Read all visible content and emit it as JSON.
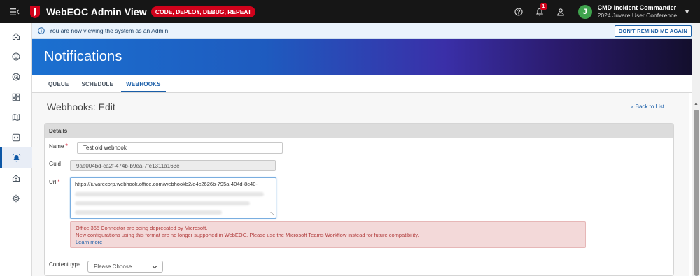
{
  "topbar": {
    "menu_icon": "menu-collapse-icon",
    "title": "WebEOC Admin View",
    "env_badge": "CODE, DEPLOY, DEBUG, REPEAT",
    "notification_count": "1",
    "user_name": "CMD Incident Commander",
    "user_org": "2024 Juvare User Conference",
    "avatar_letter": "J"
  },
  "sidebar": {
    "items": [
      {
        "name": "home-icon"
      },
      {
        "name": "user-circle-icon"
      },
      {
        "name": "radar-icon"
      },
      {
        "name": "dashboard-icon"
      },
      {
        "name": "map-icon"
      },
      {
        "name": "code-icon"
      },
      {
        "name": "alarm-bell-icon",
        "active": true
      },
      {
        "name": "house-settings-icon"
      },
      {
        "name": "gear-icon"
      }
    ]
  },
  "banner": {
    "message": "You are now viewing the system as an Admin.",
    "button": "DON'T REMIND ME AGAIN"
  },
  "hero": {
    "title": "Notifications"
  },
  "tabs": [
    {
      "label": "QUEUE"
    },
    {
      "label": "SCHEDULE"
    },
    {
      "label": "WEBHOOKS",
      "active": true
    }
  ],
  "page": {
    "title": "Webhooks: Edit",
    "back_link": "Back to List"
  },
  "details": {
    "header": "Details",
    "name_label": "Name",
    "name_value": "Test old webhook",
    "guid_label": "Guid",
    "guid_value": "9ae004bd-ca2f-474b-b9ea-7fe1311a163e",
    "url_label": "Url",
    "url_value": "https://iuvarecorp.webhook.office.com/webhookb2/e4c2626b-795a-404d-8c40-",
    "alert_line1": "Office 365 Connector are being deprecated by Microsoft.",
    "alert_line2": "New configurations using this format are no longer supported in WebEOC. Please use the Microsoft Teams Workflow instead for future compatibility.",
    "alert_link": "Learn more",
    "content_type_label": "Content type",
    "content_type_value": "Please Choose"
  },
  "colors": {
    "accent": "#1a5ea8",
    "badge_red": "#d0021b",
    "avatar_green": "#3fa34d",
    "alert_bg": "#f3d9d9"
  }
}
